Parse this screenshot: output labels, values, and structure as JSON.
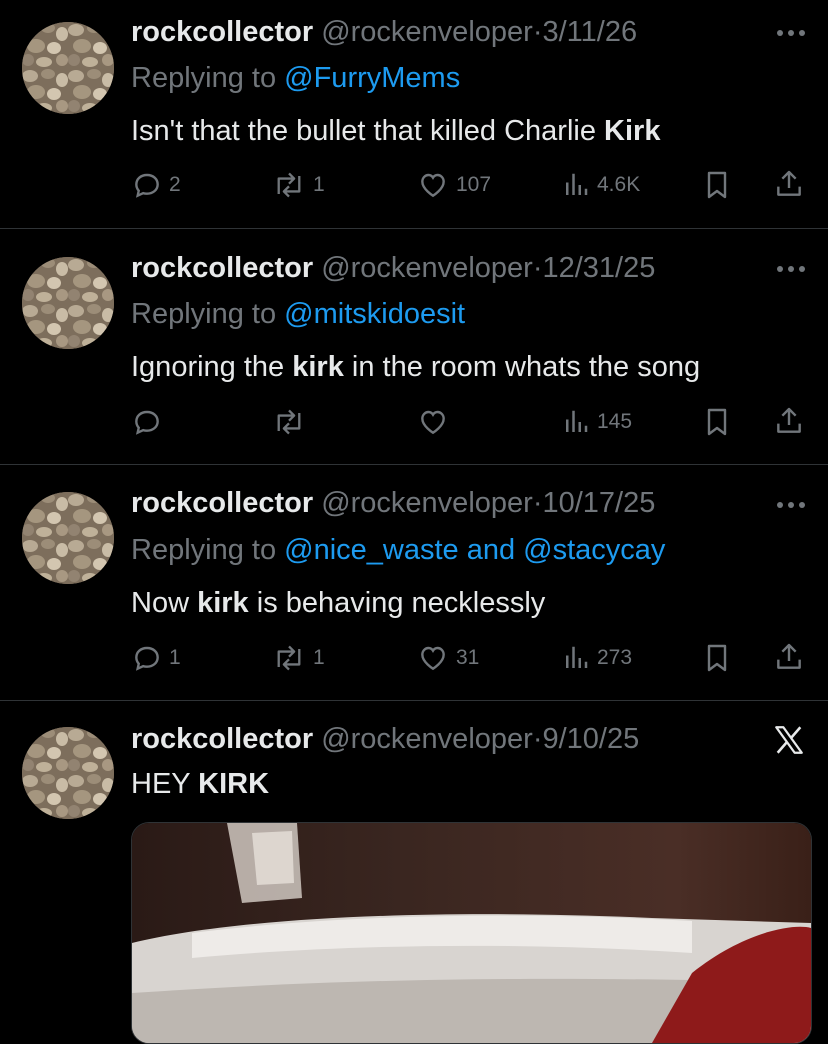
{
  "tweets": [
    {
      "name": "rockcollector",
      "handle": "@rockenveloper",
      "sep": "·",
      "date": "3/11/26",
      "replying_prefix": "Replying to ",
      "mentions": "@FurryMems",
      "text_before": "Isn't that the bullet that killed Charlie ",
      "text_bold": "Kirk",
      "text_after": "",
      "replies": "2",
      "reposts": "1",
      "likes": "107",
      "views": "4.6K"
    },
    {
      "name": "rockcollector",
      "handle": "@rockenveloper",
      "sep": "·",
      "date": "12/31/25",
      "replying_prefix": "Replying to ",
      "mentions": "@mitskidoesit",
      "text_before": "Ignoring the ",
      "text_bold": "kirk",
      "text_after": " in the room whats the song",
      "replies": "",
      "reposts": "",
      "likes": "",
      "views": "145"
    },
    {
      "name": "rockcollector",
      "handle": "@rockenveloper",
      "sep": "·",
      "date": "10/17/25",
      "replying_prefix": "Replying to ",
      "mentions": "@nice_waste and @stacycay",
      "text_before": "Now ",
      "text_bold": "kirk",
      "text_after": " is behaving necklessly",
      "replies": "1",
      "reposts": "1",
      "likes": "31",
      "views": "273"
    },
    {
      "name": "rockcollector",
      "handle": "@rockenveloper",
      "sep": "·",
      "date": "9/10/25",
      "text_before": "HEY ",
      "text_bold": "KIRK",
      "text_after": ""
    }
  ],
  "icons": {
    "more": "more-icon",
    "reply": "reply-icon",
    "repost": "repost-icon",
    "like": "heart-icon",
    "views": "views-icon",
    "bookmark": "bookmark-icon",
    "share": "share-icon",
    "x_logo": "x-logo-icon"
  },
  "colors": {
    "background": "#000000",
    "text": "#e7e9ea",
    "muted": "#71767b",
    "link": "#1d9bf0",
    "divider": "#2f3336"
  }
}
